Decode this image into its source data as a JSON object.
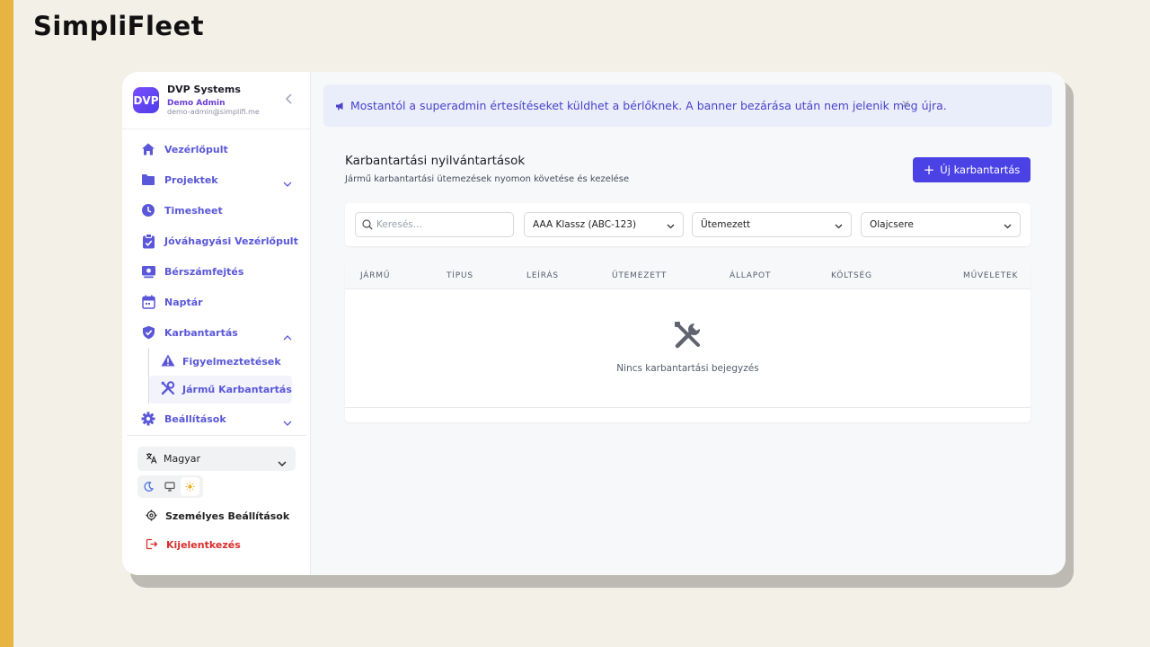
{
  "brand": "SimpliFleet",
  "account": {
    "logo_text": "DVP",
    "name": "DVP Systems",
    "role": "Demo Admin",
    "email": "demo-admin@simplifi.me"
  },
  "nav": {
    "dashboard": "Vezérlőpult",
    "projects": "Projektek",
    "timesheet": "Timesheet",
    "approval_dashboard": "Jóváhagyási Vezérlőpult",
    "payroll": "Bérszámfejtés",
    "calendar": "Naptár",
    "maintenance": "Karbantartás",
    "alerts": "Figyelmeztetések",
    "vehicle_maintenance": "Jármű Karbantartás",
    "settings": "Beállítások"
  },
  "bottom": {
    "language": "Magyar",
    "personal_settings": "Személyes Beállítások",
    "logout": "Kijelentkezés"
  },
  "banner": {
    "text": "Mostantól a superadmin értesítéseket küldhet a bérlőknek. A banner bezárása után nem jelenik meg újra."
  },
  "page": {
    "title": "Karbantartási nyilvántartások",
    "subtitle": "Jármű karbantartási ütemezések nyomon követése és kezelése",
    "new_button": "Új karbantartás"
  },
  "filters": {
    "search_placeholder": "Keresés...",
    "vehicle": "AAA Klassz (ABC-123)",
    "status": "Ütemezett",
    "type": "Olajcsere"
  },
  "table": {
    "columns": [
      "JÁRMŰ",
      "TÍPUS",
      "LEÍRÁS",
      "ÜTEMEZETT",
      "ÁLLAPOT",
      "KÖLTSÉG",
      "MŰVELETEK"
    ],
    "empty_text": "Nincs karbantartási bejegyzés"
  },
  "colors": {
    "accent": "#4b42e6",
    "nav_text": "#5a57d8",
    "logout": "#d92d2d",
    "side_strip": "#e8b441"
  }
}
